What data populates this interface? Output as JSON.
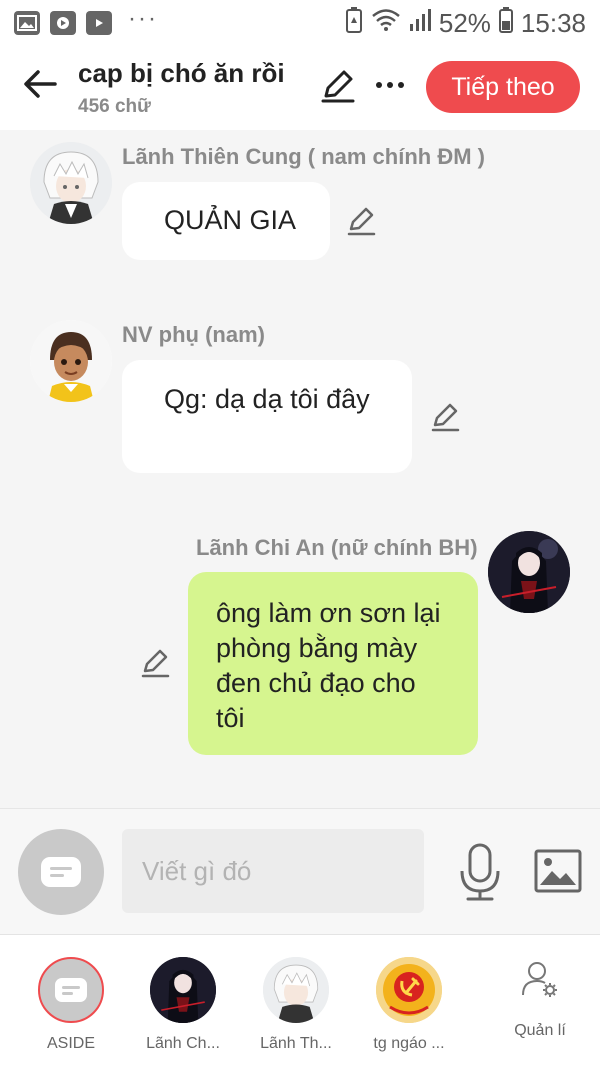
{
  "status_bar": {
    "battery_percent": "52%",
    "time": "15:38",
    "left_icons": [
      "gallery-icon",
      "video-player-icon",
      "youtube-icon",
      "more-notifications-icon"
    ],
    "right_icons": [
      "battery-saver-icon",
      "wifi-icon",
      "signal-icon",
      "battery-icon"
    ]
  },
  "header": {
    "title": "cap bị chó ăn rồi",
    "subtitle": "456 chữ",
    "next_label": "Tiếp theo",
    "accent_color": "#ef4b4e"
  },
  "messages": [
    {
      "sender": "Lãnh Thiên Cung ( nam chính ĐM )",
      "text": "QUẢN GIA",
      "side": "left",
      "avatar": "white-haired-boy-avatar"
    },
    {
      "sender": "NV phụ (nam)",
      "text": "Qg: dạ dạ tôi đây",
      "side": "left",
      "avatar": "cartoon-boy-avatar"
    },
    {
      "sender": "Lãnh Chi An (nữ chính BH)",
      "text": "ông làm ơn sơn lại phòng bằng mày đen chủ đạo cho tôi",
      "side": "right",
      "avatar": "dark-haired-girl-avatar",
      "bubble_color": "#d6f58f"
    }
  ],
  "composer": {
    "placeholder": "Viết gì đó"
  },
  "bottom_tabs": [
    {
      "label": "ASIDE",
      "icon": "aside-icon"
    },
    {
      "label": "Lãnh Ch...",
      "icon": "dark-haired-girl-avatar"
    },
    {
      "label": "Lãnh Th...",
      "icon": "white-haired-boy-avatar"
    },
    {
      "label": "tg ngáo ...",
      "icon": "hammer-sickle-avatar"
    }
  ],
  "manage_tab": {
    "label": "Quản lí",
    "icon": "user-settings-icon"
  }
}
